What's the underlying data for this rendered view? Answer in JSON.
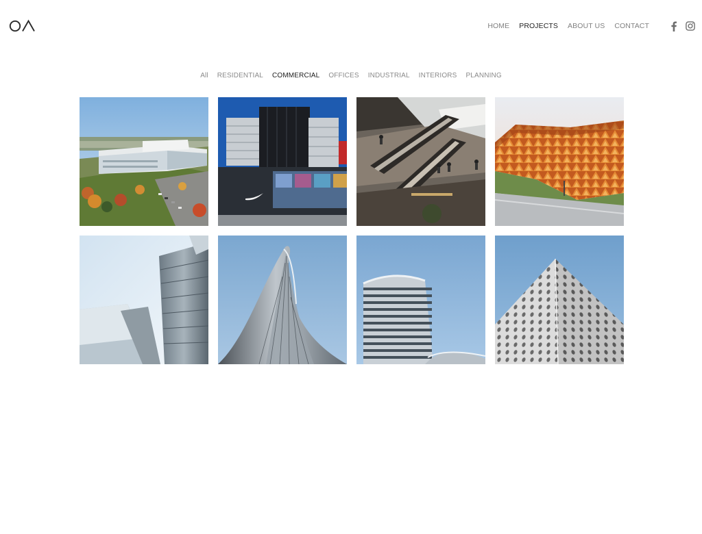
{
  "brand": {
    "logo_text": "OA"
  },
  "nav": {
    "items": [
      {
        "label": "HOME",
        "active": false
      },
      {
        "label": "PROJECTS",
        "active": true
      },
      {
        "label": "ABOUT US",
        "active": false
      },
      {
        "label": "CONTACT",
        "active": false
      }
    ],
    "social": [
      "facebook-icon",
      "instagram-icon"
    ]
  },
  "filters": [
    {
      "label": "All",
      "active": false
    },
    {
      "label": "RESIDENTIAL",
      "active": false
    },
    {
      "label": "COMMERCIAL",
      "active": true
    },
    {
      "label": "OFFICES",
      "active": false
    },
    {
      "label": "INDUSTRIAL",
      "active": false
    },
    {
      "label": "INTERIORS",
      "active": false
    },
    {
      "label": "PLANNING",
      "active": false
    }
  ],
  "projects": [
    {
      "image": "aerial-office-campus-autumn"
    },
    {
      "image": "glass-retail-building-blue-sky"
    },
    {
      "image": "mall-atrium-escalators"
    },
    {
      "image": "orange-triangular-facade-dusk"
    },
    {
      "image": "silver-curved-metal-facade"
    },
    {
      "image": "twisting-glass-tower"
    },
    {
      "image": "curved-residential-tower"
    },
    {
      "image": "perforated-white-corner-facade"
    }
  ],
  "colors": {
    "active_text": "#1f1f1f",
    "muted_text": "#808080",
    "background": "#ffffff"
  }
}
